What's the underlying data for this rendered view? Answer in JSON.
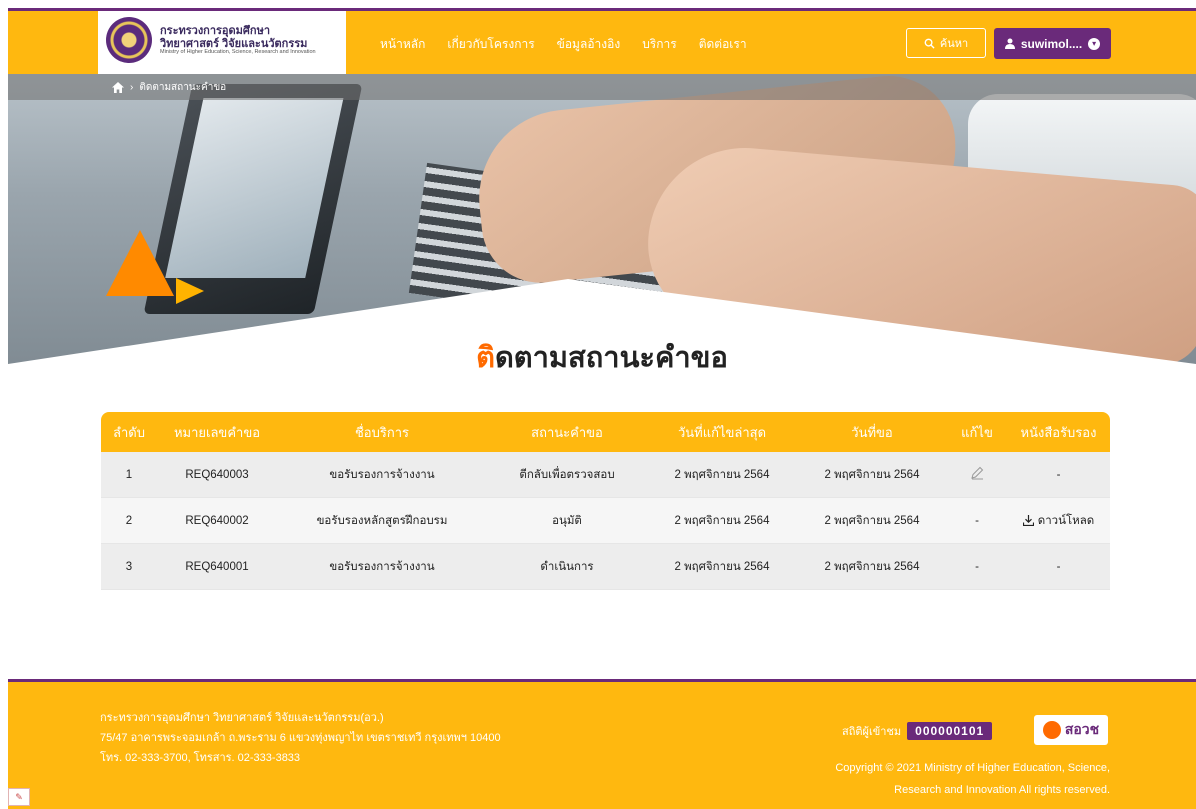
{
  "header": {
    "logo_th_line1": "กระทรวงการอุดมศึกษา",
    "logo_th_line2": "วิทยาศาสตร์ วิจัยและนวัตกรรม",
    "logo_en": "Ministry of Higher Education, Science, Research and Innovation",
    "nav": [
      "หน้าหลัก",
      "เกี่ยวกับโครงการ",
      "ข้อมูลอ้างอิง",
      "บริการ",
      "ติดต่อเรา"
    ],
    "search_label": "ค้นหา",
    "user_label": "suwimol...."
  },
  "breadcrumb": {
    "current": "ติดตามสถานะคำขอ"
  },
  "page": {
    "title_first": "ติ",
    "title_rest": "ดตามสถานะคำขอ"
  },
  "table": {
    "headers": [
      "ลำดับ",
      "หมายเลขคำขอ",
      "ชื่อบริการ",
      "สถานะคำขอ",
      "วันที่แก้ไขล่าสุด",
      "วันที่ขอ",
      "แก้ไข",
      "หนังสือรับรอง"
    ],
    "rows": [
      {
        "no": "1",
        "req": "REQ640003",
        "service": "ขอรับรองการจ้างงาน",
        "status": "ตีกลับเพื่อตรวจสอบ",
        "updated": "2 พฤศจิกายน 2564",
        "requested": "2 พฤศจิกายน 2564",
        "edit": "",
        "cert": "-"
      },
      {
        "no": "2",
        "req": "REQ640002",
        "service": "ขอรับรองหลักสูตรฝึกอบรม",
        "status": "อนุมัติ",
        "updated": "2 พฤศจิกายน 2564",
        "requested": "2 พฤศจิกายน 2564",
        "edit": "-",
        "cert": "ดาวน์โหลด"
      },
      {
        "no": "3",
        "req": "REQ640001",
        "service": "ขอรับรองการจ้างงาน",
        "status": "ดำเนินการ",
        "updated": "2 พฤศจิกายน 2564",
        "requested": "2 พฤศจิกายน 2564",
        "edit": "-",
        "cert": "-"
      }
    ]
  },
  "footer": {
    "org": "กระทรวงการอุดมศึกษา วิทยาศาสตร์ วิจัยและนวัตกรรม(อว.)",
    "address": "75/47 อาคารพระจอมเกล้า ถ.พระราม 6 แขวงทุ่งพญาไท เขตราชเทวี กรุงเทพฯ 10400",
    "phone": "โทร. 02-333-3700, โทรสาร. 02-333-3833",
    "stats_label": "สถิติผู้เข้าชม",
    "visitor_count": "000000101",
    "brand": "สอวช",
    "copyright_line1": "Copyright © 2021 Ministry of Higher Education, Science,",
    "copyright_line2": "Research and Innovation All rights reserved."
  },
  "colors": {
    "accent": "#ffb80f",
    "purple": "#6a2a7a",
    "title_highlight": "#ff6a00"
  }
}
